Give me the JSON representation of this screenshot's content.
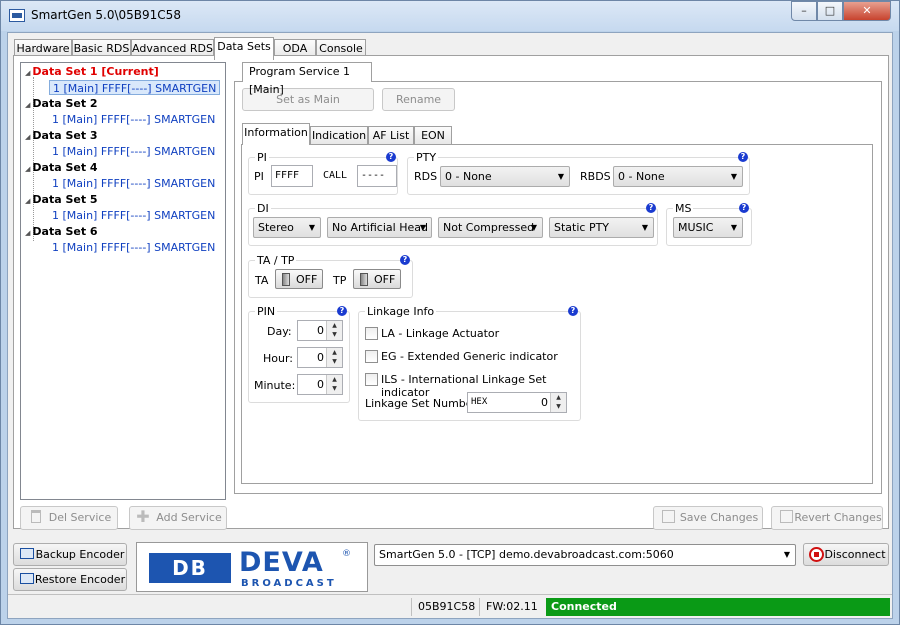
{
  "window": {
    "title": "SmartGen 5.0\\05B91C58",
    "min_icon": "minimize-icon",
    "max_icon": "maximize-icon",
    "close_icon": "close-icon",
    "min": "–",
    "max": "□",
    "close": "✕"
  },
  "main_tabs": [
    "Hardware",
    "Basic RDS",
    "Advanced RDS",
    "Data Sets",
    "ODA",
    "Console"
  ],
  "tree": {
    "sets": [
      {
        "label": "Data Set 1 [Current]",
        "service": "1 [Main] FFFF[----] SMARTGEN"
      },
      {
        "label": "Data Set 2",
        "service": "1 [Main] FFFF[----] SMARTGEN"
      },
      {
        "label": "Data Set 3",
        "service": "1 [Main] FFFF[----] SMARTGEN"
      },
      {
        "label": "Data Set 4",
        "service": "1 [Main] FFFF[----] SMARTGEN"
      },
      {
        "label": "Data Set 5",
        "service": "1 [Main] FFFF[----] SMARTGEN"
      },
      {
        "label": "Data Set 6",
        "service": "1 [Main] FFFF[----] SMARTGEN"
      }
    ],
    "current_color": "#e00000",
    "service_color": "#1040c0"
  },
  "service_tab": "Program Service 1 [Main]",
  "buttons": {
    "set_as_main": "Set as Main",
    "rename": "Rename",
    "del_service": "Del Service",
    "add_service": "Add Service",
    "save_changes": "Save Changes",
    "revert_changes": "Revert Changes",
    "backup": "Backup Encoder",
    "restore": "Restore Encoder",
    "disconnect": "Disconnect"
  },
  "info_tabs": [
    "Information",
    "Indication",
    "AF List",
    "EON"
  ],
  "pi": {
    "group": "PI",
    "pi_label": "PI",
    "pi_value": "FFFF",
    "call_label": "CALL",
    "call_value": "----",
    "help": "?"
  },
  "pty": {
    "group": "PTY",
    "rds_label": "RDS",
    "rds_value": "0 - None",
    "rbds_label": "RBDS",
    "rbds_value": "0 - None",
    "help": "?"
  },
  "di": {
    "group": "DI",
    "values": [
      "Stereo",
      "No Artificial Head",
      "Not Compressed",
      "Static PTY"
    ],
    "help": "?"
  },
  "ms": {
    "group": "MS",
    "value": "MUSIC",
    "help": "?"
  },
  "tatp": {
    "group": "TA / TP",
    "ta_label": "TA",
    "ta_state": "OFF",
    "tp_label": "TP",
    "tp_state": "OFF",
    "help": "?"
  },
  "pin": {
    "group": "PIN",
    "day_label": "Day:",
    "day": "0",
    "hour_label": "Hour:",
    "hour": "0",
    "minute_label": "Minute:",
    "minute": "0",
    "help": "?",
    "up": "▲",
    "down": "▼"
  },
  "linkage": {
    "group": "Linkage Info",
    "la": "LA - Linkage Actuator",
    "eg": "EG - Extended Generic indicator",
    "ils": "ILS - International Linkage Set indicator",
    "lsn_label": "Linkage Set Number",
    "lsn_prefix": "HEX",
    "lsn_value": "0",
    "help": "?"
  },
  "connection": {
    "value": "SmartGen 5.0 - [TCP] demo.devabroadcast.com:5060"
  },
  "logo": {
    "text": "DEVA",
    "sub": "BROADCAST",
    "reg": "®",
    "mark": "DB"
  },
  "status": {
    "serial": "05B91C58",
    "fw": "FW:02.11",
    "state": "Connected",
    "state_color": "#0a9a16"
  },
  "combo_arrow": "▼"
}
